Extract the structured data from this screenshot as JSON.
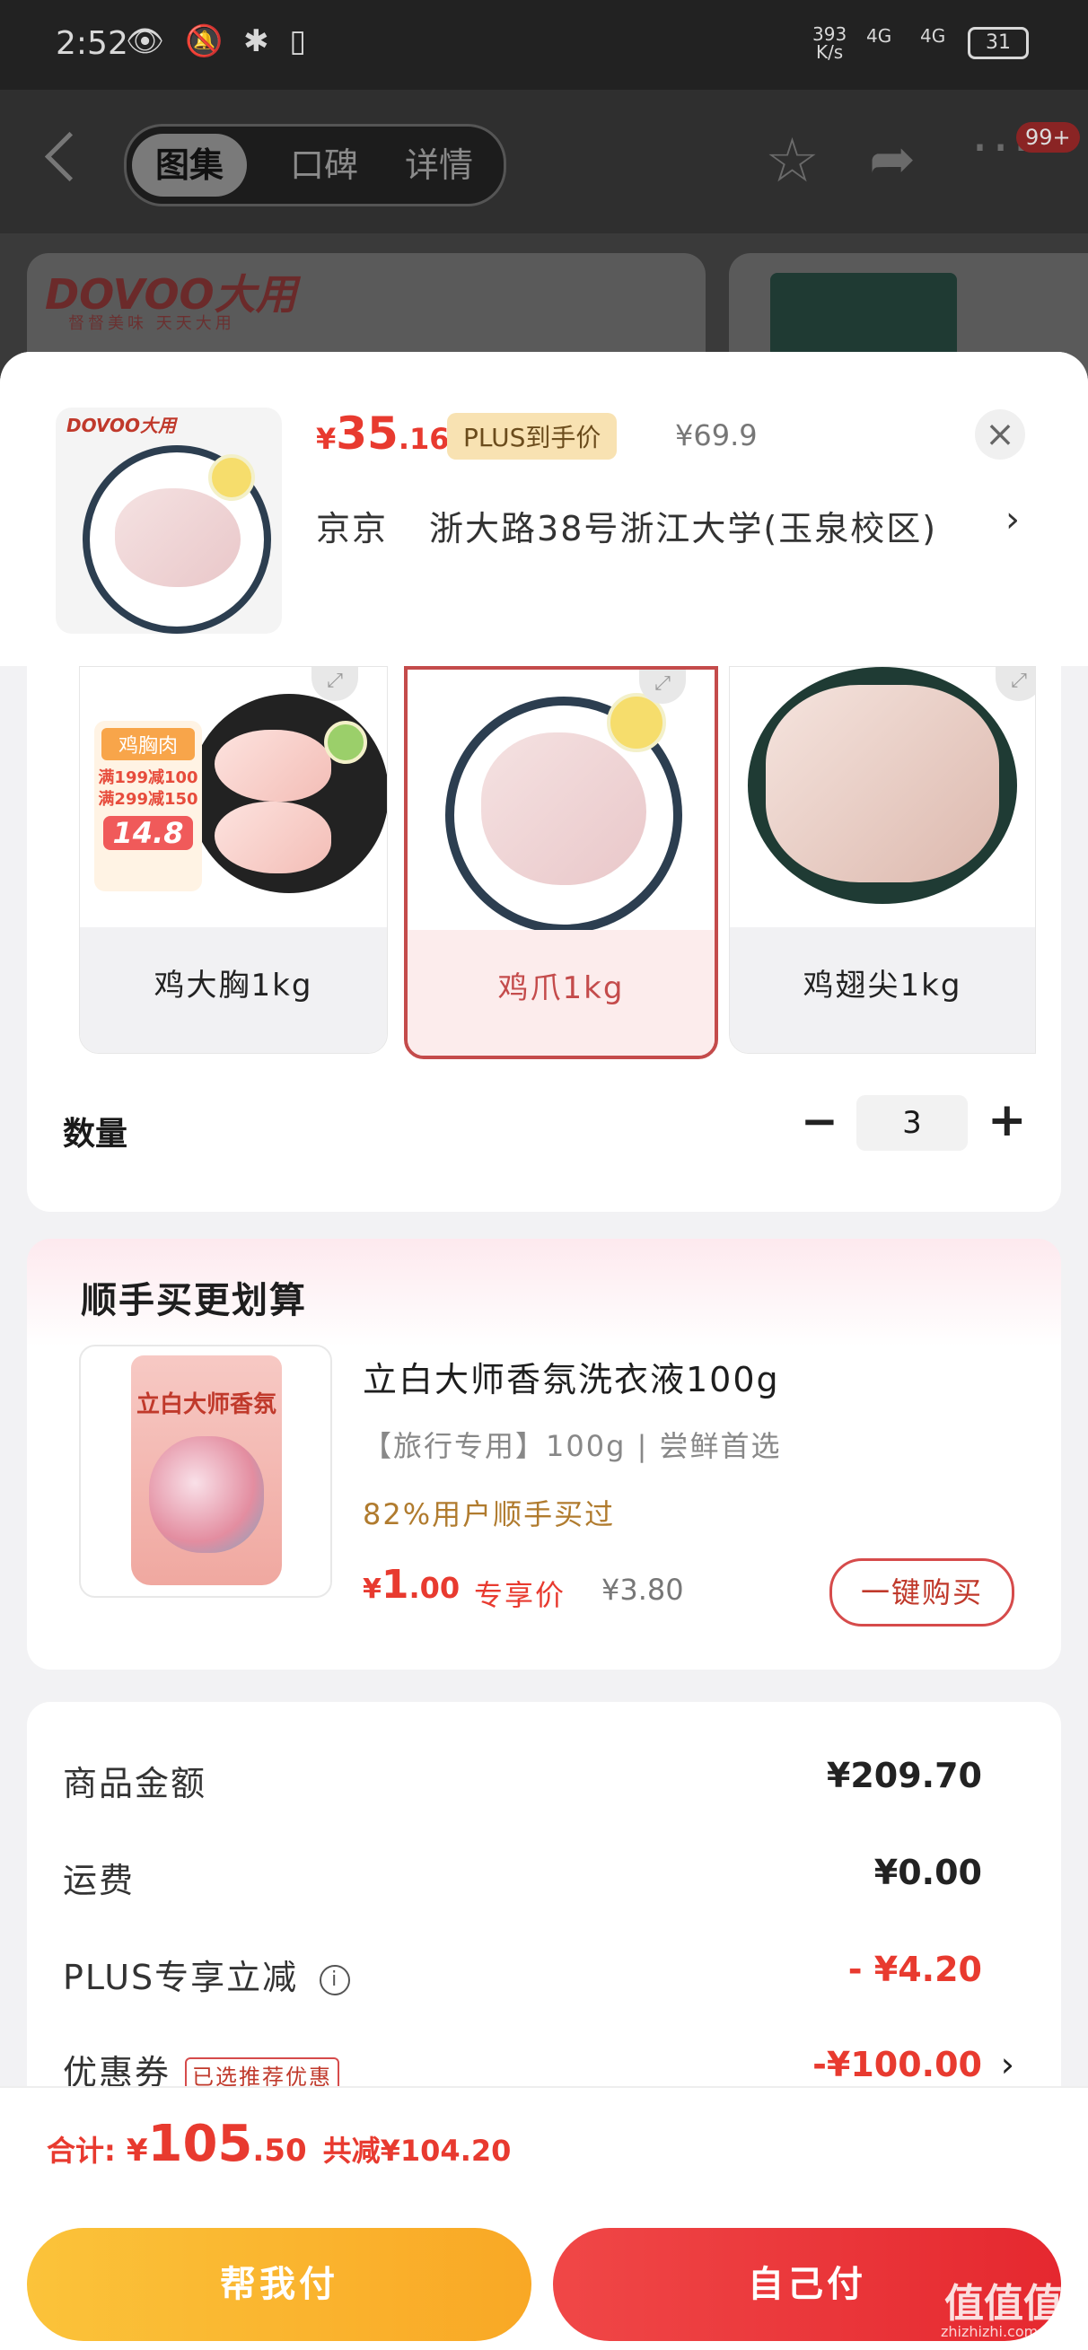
{
  "status_bar": {
    "time": "2:52",
    "icons": "👁 🔕 ✱ ▯",
    "net_speed_top": "393",
    "net_speed_bottom": "K/s",
    "signal1": "4G",
    "signal2": "4G",
    "battery": "31"
  },
  "top_nav": {
    "tabs": [
      "图集",
      "口碑",
      "详情"
    ],
    "active_tab": "图集",
    "badge": "99+"
  },
  "background": {
    "brand_text": "DOVOO大用",
    "slogan": "督督美味  天天大用",
    "brand_small": "DOVOO大用"
  },
  "product": {
    "logo": "DOVOO大用",
    "price_symbol": "¥",
    "price_int": "35",
    "price_dec": ".16",
    "plus_tag": "PLUS到手价",
    "original_price": "¥69.9",
    "city": "京京",
    "address": "浙大路38号浙江大学(玉泉校区)"
  },
  "specs": [
    {
      "label": "鸡大胸1kg",
      "selected": false
    },
    {
      "label": "鸡爪1kg",
      "selected": true
    },
    {
      "label": "鸡翅尖1kg",
      "selected": false
    }
  ],
  "promo_badge": {
    "title": "鸡胸肉",
    "line1": "满199减100",
    "line2": "满299减150",
    "price": "14.8"
  },
  "quantity": {
    "label": "数量",
    "value": "3"
  },
  "upsell": {
    "title": "顺手买更划算",
    "pouch_brand": "立白大师香氛",
    "name": "立白大师香氛洗衣液100g",
    "subtitle": "【旅行专用】100g | 尝鲜首选",
    "stat": "82%用户顺手买过",
    "price_symbol": "¥",
    "price_int": "1",
    "price_dec": ".00",
    "price_tag": "专享价",
    "original_price": "¥3.80",
    "buy_button": "一键购买"
  },
  "summary": {
    "rows": [
      {
        "label": "商品金额",
        "value": "¥209.70"
      },
      {
        "label": "运费",
        "value": "¥0.00"
      },
      {
        "label": "PLUS专享立减",
        "value": "- ¥4.20"
      },
      {
        "label": "优惠券",
        "tag": "已选推荐优惠",
        "value": "-¥100.00"
      }
    ]
  },
  "footer": {
    "total_label": "合计:",
    "total_symbol": "¥",
    "total_int": "105",
    "total_dec": ".50",
    "saved": "共减¥104.20",
    "help_pay": "帮我付",
    "self_pay": "自己付"
  },
  "watermark": {
    "text": "值值值",
    "sub": "zhizhizhi.com"
  },
  "colors": {
    "accent_red": "#e83a2f",
    "gold": "#f9a825",
    "plus_tag_bg": "#f8e2b2"
  }
}
